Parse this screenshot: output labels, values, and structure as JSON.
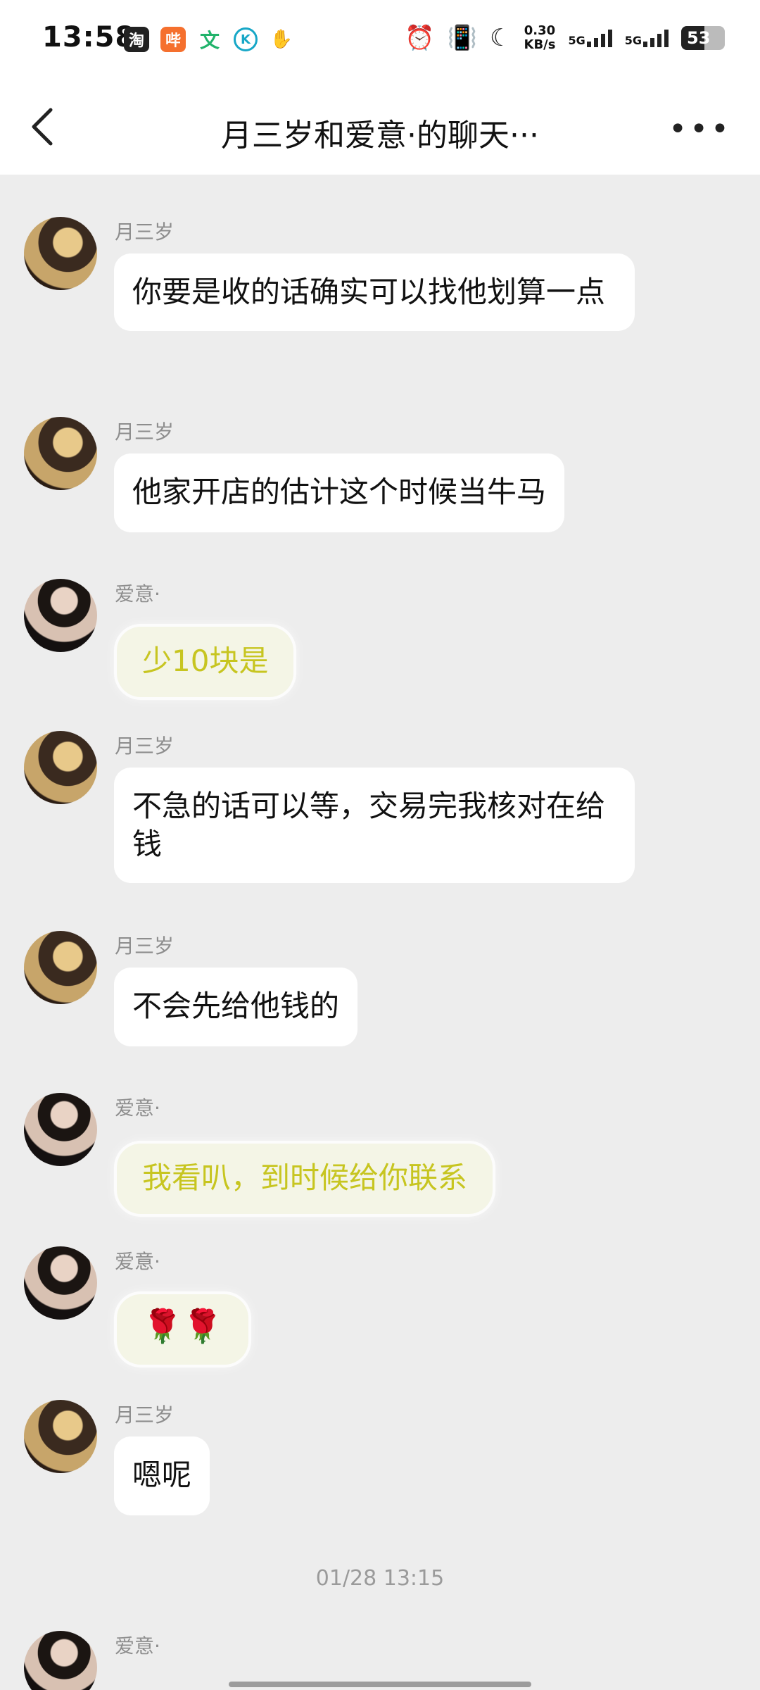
{
  "status_bar": {
    "time": "13:58",
    "app_icons": [
      "淘",
      "哔",
      "文",
      "K",
      "✋"
    ],
    "net_speed_value": "0.30",
    "net_speed_unit": "KB/s",
    "signal1_label": "5G",
    "signal2_label": "5G",
    "battery": "53"
  },
  "nav": {
    "title": "月三岁和爱意·的聊天···"
  },
  "messages": [
    {
      "sender": "月三岁",
      "text": "你要是收的话确实可以找他划算一点"
    },
    {
      "sender": "月三岁",
      "text": "他家开店的估计这个时候当牛马"
    },
    {
      "sender": "爱意·",
      "text": "少10块是"
    },
    {
      "sender": "月三岁",
      "text": "不急的话可以等，交易完我核对在给钱"
    },
    {
      "sender": "月三岁",
      "text": "不会先给他钱的"
    },
    {
      "sender": "爱意·",
      "text": "我看叭，到时候给你联系"
    },
    {
      "sender": "爱意·",
      "text": "🌹🌹"
    },
    {
      "sender": "月三岁",
      "text": "嗯呢"
    },
    {
      "sender": "爱意·",
      "text": ""
    }
  ],
  "timestamp": "01/28 13:15",
  "colors": {
    "background": "#ededed",
    "bubble": "#ffffff",
    "fancy_bubble_text": "#c7c520"
  }
}
